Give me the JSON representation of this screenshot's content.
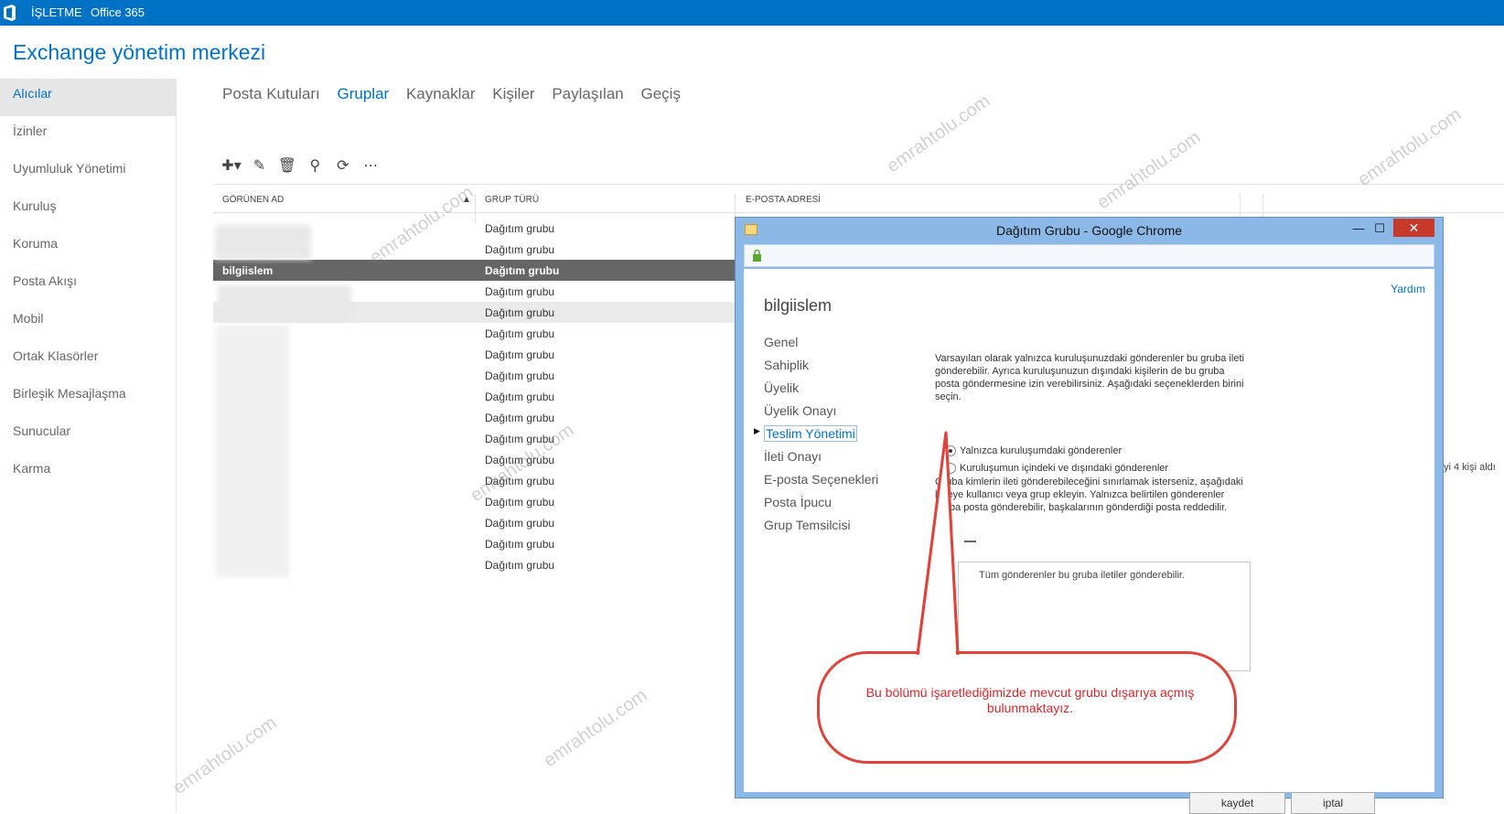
{
  "topbar": {
    "brand": "İŞLETME",
    "product": "Office 365"
  },
  "app_title": "Exchange yönetim merkezi",
  "sidebar": {
    "items": [
      {
        "label": "Alıcılar",
        "active": true
      },
      {
        "label": "İzinler"
      },
      {
        "label": "Uyumluluk Yönetimi"
      },
      {
        "label": "Kuruluş"
      },
      {
        "label": "Koruma"
      },
      {
        "label": "Posta Akışı"
      },
      {
        "label": "Mobil"
      },
      {
        "label": "Ortak Klasörler"
      },
      {
        "label": "Birleşik Mesajlaşma"
      },
      {
        "label": "Sunucular"
      },
      {
        "label": "Karma"
      }
    ]
  },
  "tabs": [
    "Posta Kutuları",
    "Gruplar",
    "Kaynaklar",
    "Kişiler",
    "Paylaşılan",
    "Geçiş"
  ],
  "active_tab": "Gruplar",
  "toolbar": [
    "add-icon",
    "edit-icon",
    "delete-icon",
    "search-icon",
    "refresh-icon",
    "more-icon"
  ],
  "grid": {
    "columns": [
      "GÖRÜNEN AD",
      "GRUP TÜRÜ",
      "E-POSTA ADRESİ"
    ],
    "rows": [
      {
        "name": "",
        "type": "Dağıtım grubu"
      },
      {
        "name": "",
        "type": "Dağıtım grubu"
      },
      {
        "name": "bilgiislem",
        "type": "Dağıtım grubu",
        "selected": true
      },
      {
        "name": "",
        "type": "Dağıtım grubu"
      },
      {
        "name": "",
        "type": "Dağıtım grubu",
        "hover": true
      },
      {
        "name": "",
        "type": "Dağıtım grubu"
      },
      {
        "name": "",
        "type": "Dağıtım grubu"
      },
      {
        "name": "",
        "type": "Dağıtım grubu"
      },
      {
        "name": "",
        "type": "Dağıtım grubu"
      },
      {
        "name": "",
        "type": "Dağıtım grubu"
      },
      {
        "name": "",
        "type": "Dağıtım grubu"
      },
      {
        "name": "",
        "type": "Dağıtım grubu"
      },
      {
        "name": "",
        "type": "Dağıtım grubu"
      },
      {
        "name": "",
        "type": "Dağıtım grubu"
      },
      {
        "name": "",
        "type": "Dağıtım grubu"
      },
      {
        "name": "",
        "type": "Dağıtım grubu"
      },
      {
        "name": "",
        "type": "Dağıtım grubu"
      }
    ]
  },
  "right_note": "yi 4 kişi aldı",
  "watermark": "emrahtolu.com",
  "dialog": {
    "title": "Dağıtım Grubu - Google Chrome",
    "minimize": "—",
    "maximize": "☐",
    "close": "✕",
    "help": "Yardım",
    "group_name": "bilgiislem",
    "nav": [
      "Genel",
      "Sahiplik",
      "Üyelik",
      "Üyelik Onayı",
      "Teslim Yönetimi",
      "İleti Onayı",
      "E-posta Seçenekleri",
      "Posta İpucu",
      "Grup Temsilcisi"
    ],
    "active_nav": "Teslim Yönetimi",
    "description": "Varsayılan olarak yalnızca kuruluşunuzdaki gönderenler bu gruba ileti gönderebilir. Ayrıca kuruluşunuzun dışındaki kişilerin de bu gruba posta göndermesine izin verebilirsiniz. Aşağıdaki seçeneklerden birini seçin.",
    "radio_inside": "Yalnızca kuruluşumdaki gönderenler",
    "radio_outside": "Kuruluşumun içindeki ve dışındaki gönderenler",
    "description2": "Gruba kimlerin ileti gönderebileceğini sınırlamak isterseniz, aşağıdaki listeye kullanıcı veya grup ekleyin. Yalnızca belirtilen gönderenler gruba posta gönderebilir, başkalarının gönderdiği posta reddedilir.",
    "list_text": "Tüm gönderenler bu gruba iletiler gönderebilir.",
    "save": "kaydet",
    "cancel": "iptal"
  },
  "callout": "Bu bölümü işaretlediğimizde mevcut grubu dışarıya açmış bulunmaktayız.",
  "colors": {
    "accent": "#0072c6",
    "callout": "#e0433b"
  }
}
